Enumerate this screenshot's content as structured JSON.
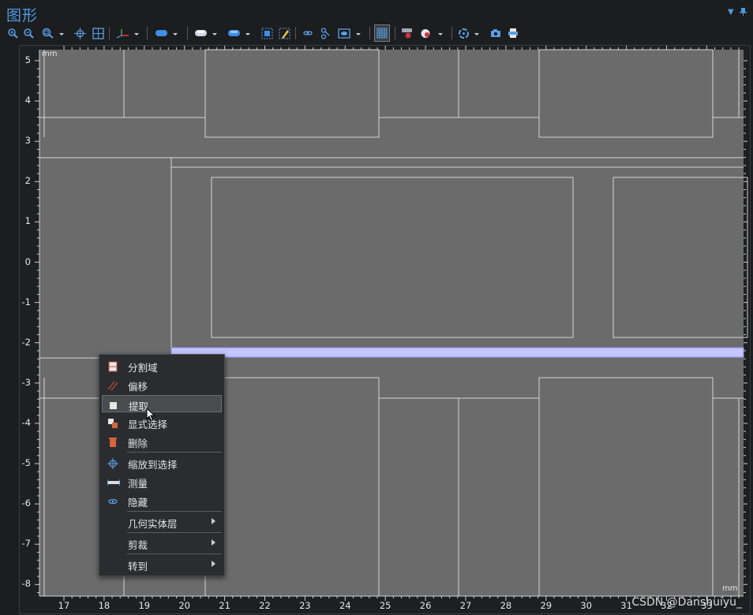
{
  "window": {
    "title": "图形"
  },
  "toolbar": {
    "icons": [
      "zoom-in-icon",
      "zoom-out-icon",
      "zoom-box-icon",
      "pan-icon",
      "zoom-extents-icon",
      "axes-icon",
      "select-domain-icon",
      "select-boundary-icon",
      "select-edge-icon",
      "zoom-selection-icon",
      "paint-icon",
      "link-icon",
      "selection-list-icon",
      "view-icon",
      "grid-toggle-icon",
      "lighting-icon",
      "render-icon",
      "rotate-icon",
      "camera-icon",
      "print-icon"
    ]
  },
  "plot": {
    "x_unit": "mm",
    "y_unit": "mm",
    "x_ticks": [
      "17",
      "18",
      "19",
      "20",
      "21",
      "22",
      "23",
      "24",
      "25",
      "26",
      "27",
      "28",
      "29",
      "30",
      "31",
      "32",
      "33"
    ],
    "y_ticks": [
      "5",
      "4",
      "3",
      "2",
      "1",
      "0",
      "-1",
      "-2",
      "-3",
      "-4",
      "-5",
      "-6",
      "-7",
      "-8"
    ],
    "colors": {
      "background": "#6b6b6b",
      "edge": "#d6d6d6",
      "highlight": "#c3c6ff"
    }
  },
  "context_menu": {
    "items": [
      {
        "label": "分割域",
        "icon": "split-domain-icon"
      },
      {
        "label": "偏移",
        "icon": "offset-icon"
      },
      {
        "label": "提取",
        "icon": "extract-icon",
        "hovered": true
      },
      {
        "label": "显式选择",
        "icon": "explicit-selection-icon"
      },
      {
        "label": "删除",
        "icon": "delete-icon"
      },
      {
        "label": "缩放到选择",
        "icon": "zoom-to-selection-icon"
      },
      {
        "label": "测量",
        "icon": "measure-icon"
      },
      {
        "label": "隐藏",
        "icon": "hide-icon"
      },
      {
        "label": "几何实体层",
        "submenu": true
      },
      {
        "label": "剪裁",
        "submenu": true
      },
      {
        "label": "转到",
        "submenu": true
      }
    ]
  },
  "watermark": "CSDN @Danshuiyu_"
}
